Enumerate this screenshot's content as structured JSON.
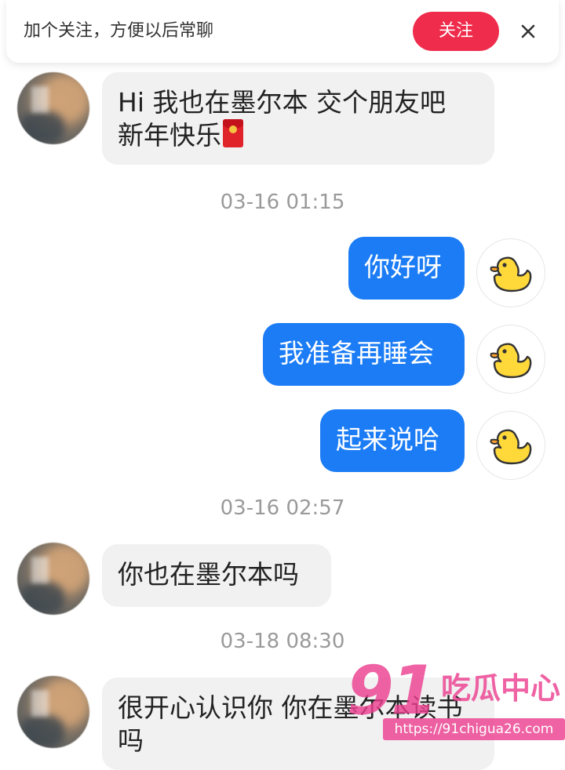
{
  "follow_bar": {
    "text": "加个关注，方便以后常聊",
    "button_label": "关注",
    "close_icon": "close-icon"
  },
  "colors": {
    "incoming_bubble": "#f1f1f1",
    "outgoing_bubble": "#1b7cf5",
    "follow_button": "#ef2c4c",
    "timestamp_text": "#9a9a9a",
    "watermark": "#ec4090"
  },
  "messages": [
    {
      "direction": "in",
      "lines": [
        "Hi 我也在墨尔本 交个朋友吧",
        "新年快乐"
      ],
      "trailing_icon": "red-packet-emoji"
    },
    {
      "timestamp": "03-16 01:15"
    },
    {
      "direction": "out",
      "text": "你好呀",
      "avatar_icon": "duck-icon"
    },
    {
      "direction": "out",
      "text": "我准备再睡会",
      "avatar_icon": "duck-icon"
    },
    {
      "direction": "out",
      "text": "起来说哈",
      "avatar_icon": "duck-icon"
    },
    {
      "timestamp": "03-16 02:57"
    },
    {
      "direction": "in",
      "text": "你也在墨尔本吗"
    },
    {
      "timestamp": "03-18 08:30"
    },
    {
      "direction": "in",
      "lines": [
        "很开心认识你 你在墨尔本读书",
        "吗"
      ]
    }
  ],
  "watermark": {
    "logo": "91",
    "name": "吃瓜中心",
    "url": "https://91chigua26.com"
  }
}
